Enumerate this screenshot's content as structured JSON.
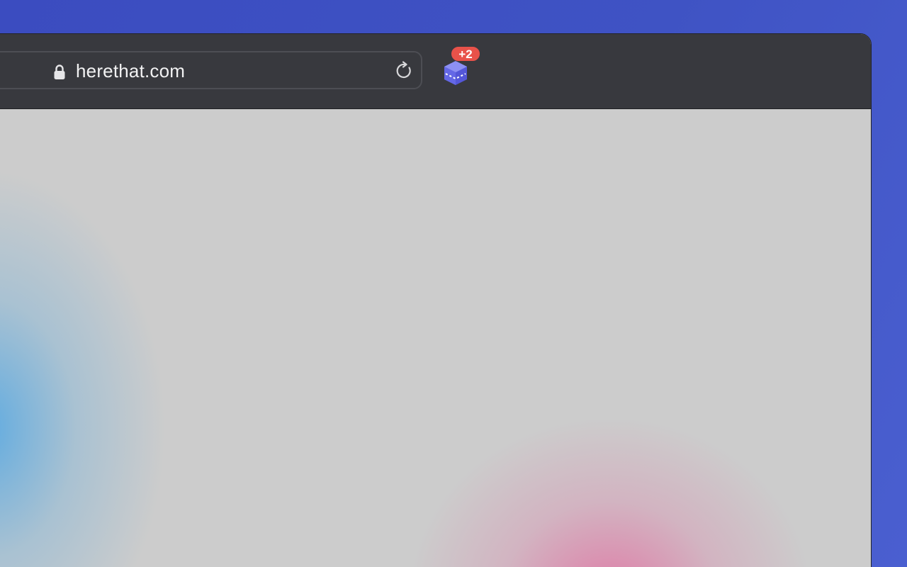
{
  "address_bar": {
    "url": "herethat.com",
    "secure_icon": "lock-icon",
    "reload_icon": "reload-icon"
  },
  "extension": {
    "icon": "cube-icon",
    "badge": "+2"
  },
  "colors": {
    "desktop_background": "#3f53c4",
    "toolbar_background": "#38393e",
    "badge_background": "#e8524a",
    "extension_icon": "#6b6ee8"
  }
}
